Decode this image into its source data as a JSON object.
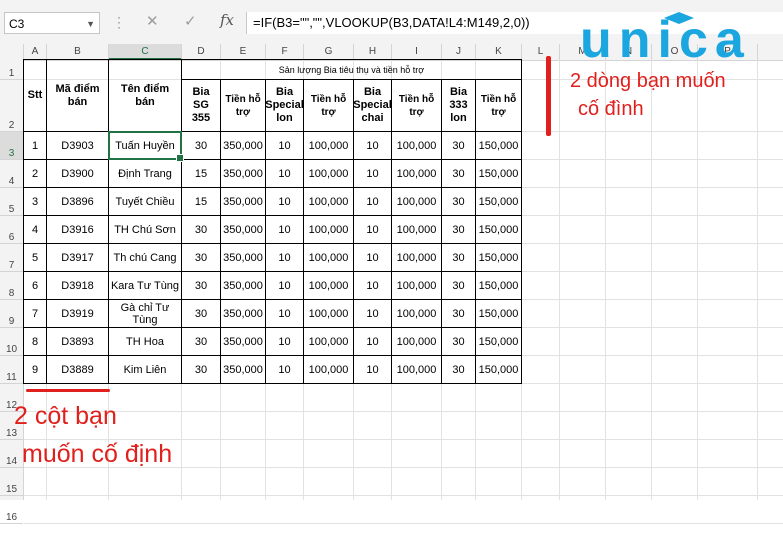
{
  "formula_bar": {
    "name_box": "C3",
    "formula": "=IF(B3=\"\",\"\",VLOOKUP(B3,DATA!L4:M149,2,0))",
    "fx_label": "fx",
    "cancel_glyph": "✕",
    "enter_glyph": "✓"
  },
  "columns": [
    "A",
    "B",
    "C",
    "D",
    "E",
    "F",
    "G",
    "H",
    "I",
    "J",
    "K",
    "L",
    "M",
    "N",
    "O",
    "P"
  ],
  "rows": [
    "1",
    "2",
    "3",
    "4",
    "5",
    "6",
    "7",
    "8",
    "9",
    "10",
    "11",
    "12",
    "13",
    "14",
    "15",
    "16"
  ],
  "selected_cell": "C3",
  "table": {
    "group_header": "Sản lượng Bia tiêu thụ và tiền hỗ trợ",
    "headers": [
      "Stt",
      "Mã điểm bán",
      "Tên điểm bán",
      "Bia SG 355",
      "Tiền hỗ trợ",
      "Bia Special lon",
      "Tiền hỗ trợ",
      "Bia Special chai",
      "Tiền hỗ trợ",
      "Bia 333 lon",
      "Tiền hỗ trợ"
    ],
    "rows": [
      [
        "1",
        "D3903",
        "Tuấn Huyền",
        "30",
        "350,000",
        "10",
        "100,000",
        "10",
        "100,000",
        "30",
        "150,000"
      ],
      [
        "2",
        "D3900",
        "Định Trang",
        "15",
        "350,000",
        "10",
        "100,000",
        "10",
        "100,000",
        "30",
        "150,000"
      ],
      [
        "3",
        "D3896",
        "Tuyết Chiều",
        "15",
        "350,000",
        "10",
        "100,000",
        "10",
        "100,000",
        "30",
        "150,000"
      ],
      [
        "4",
        "D3916",
        "TH Chú Sơn",
        "30",
        "350,000",
        "10",
        "100,000",
        "10",
        "100,000",
        "30",
        "150,000"
      ],
      [
        "5",
        "D3917",
        "Th chú Cang",
        "30",
        "350,000",
        "10",
        "100,000",
        "10",
        "100,000",
        "30",
        "150,000"
      ],
      [
        "6",
        "D3918",
        "Kara Tư Tùng",
        "30",
        "350,000",
        "10",
        "100,000",
        "10",
        "100,000",
        "30",
        "150,000"
      ],
      [
        "7",
        "D3919",
        "Gà chỉ Tư Tùng",
        "30",
        "350,000",
        "10",
        "100,000",
        "10",
        "100,000",
        "30",
        "150,000"
      ],
      [
        "8",
        "D3893",
        "TH Hoa",
        "30",
        "350,000",
        "10",
        "100,000",
        "10",
        "100,000",
        "30",
        "150,000"
      ],
      [
        "9",
        "D3889",
        "Kim Liên",
        "30",
        "350,000",
        "10",
        "100,000",
        "10",
        "100,000",
        "30",
        "150,000"
      ]
    ]
  },
  "annotations": {
    "rows_note_line1": "2 dòng bạn muốn",
    "rows_note_line2": "cố đình",
    "cols_note_line1": "2 cột bạn",
    "cols_note_line2": "muốn cố định",
    "color": "#e0201d"
  },
  "logo": {
    "text": "unica",
    "color": "#1ba6e0"
  },
  "colors": {
    "excel_green": "#217346",
    "gridline": "#e2e2e2"
  }
}
